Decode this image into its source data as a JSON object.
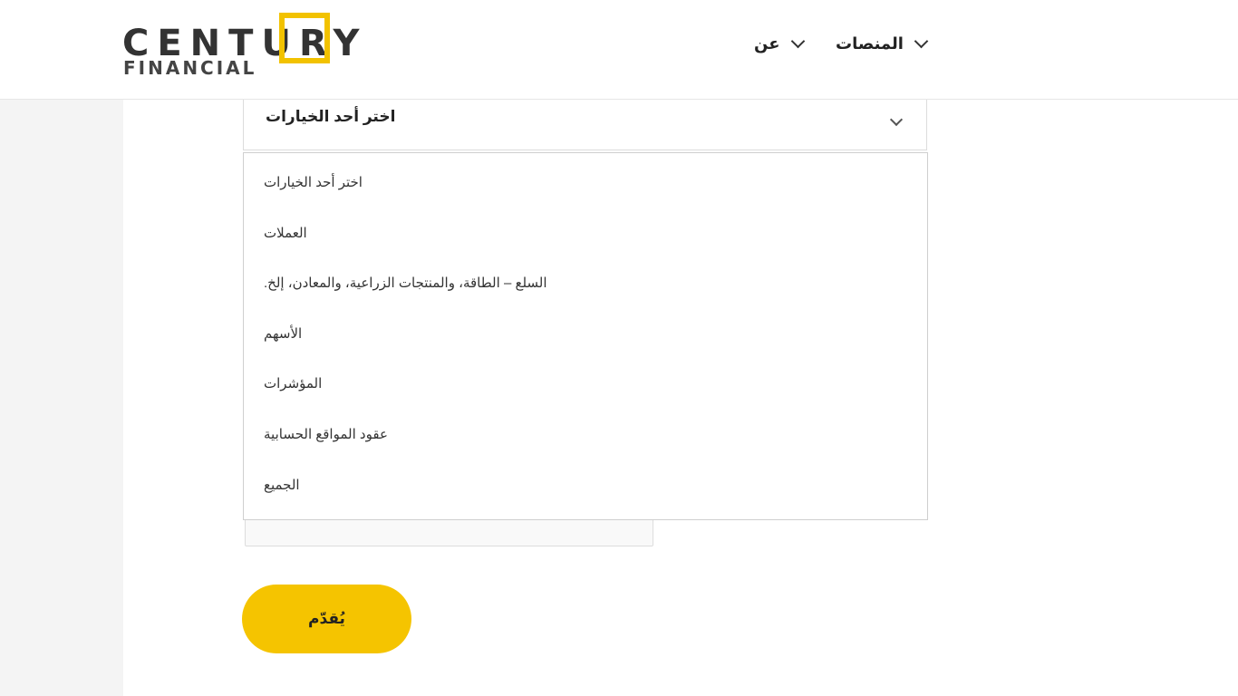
{
  "header": {
    "logo": {
      "word_left": "CENT",
      "word_u": "U",
      "word_right": "RY",
      "subtitle": "FINANCIAL",
      "accent_color": "#f2c200"
    },
    "nav": {
      "platforms_label": "المنصات",
      "about_label": "عن"
    }
  },
  "form": {
    "select": {
      "selected_value": "اختر أحد الخيارات",
      "options": [
        "اختر أحد الخيارات",
        "العملات",
        "السلع – الطاقة، والمنتجات الزراعية، والمعادن، إلخ.",
        "الأسهم",
        "المؤشرات",
        "عقود المواقع الحسابية",
        "الجميع"
      ]
    },
    "submit_label": "يُقدّم",
    "submit_color": "#f5c400"
  }
}
